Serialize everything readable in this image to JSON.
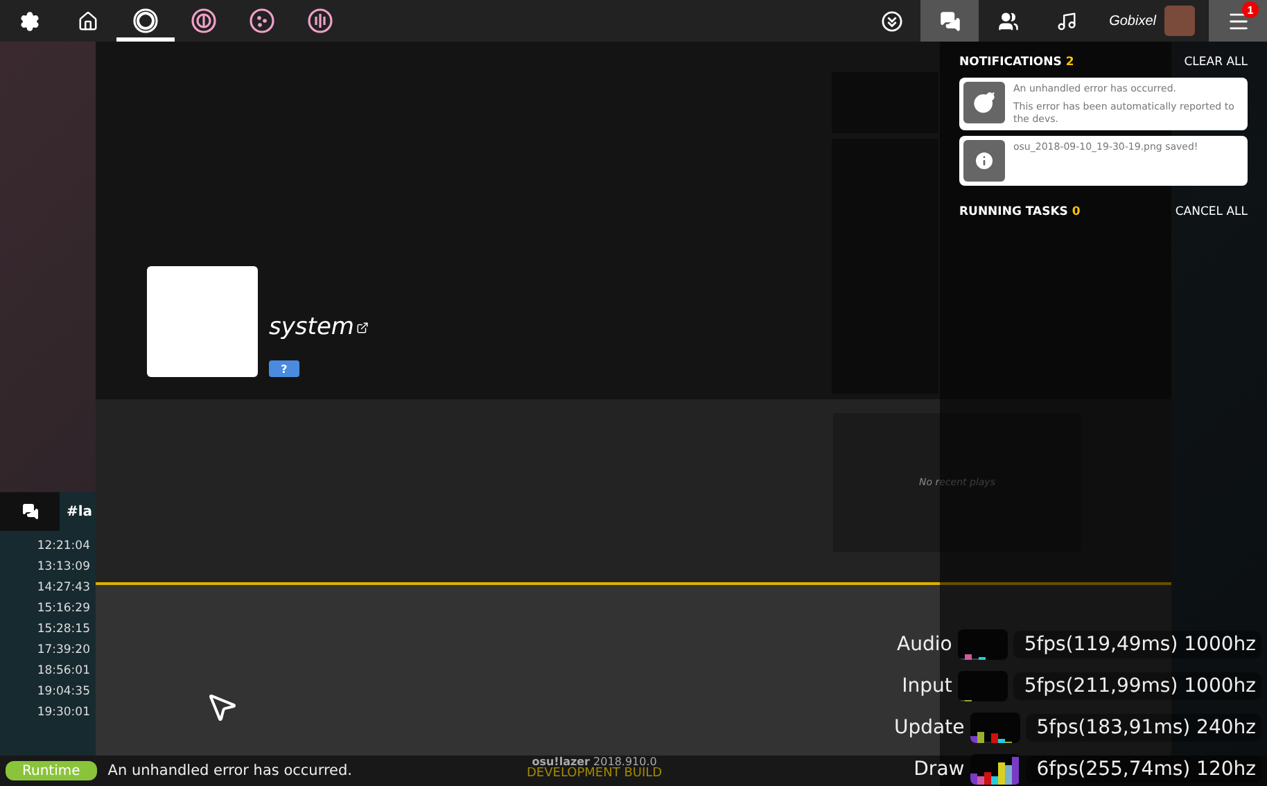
{
  "toolbar": {
    "rulesets": [
      {
        "kind": "osu",
        "selected": true
      },
      {
        "kind": "taiko",
        "selected": false
      },
      {
        "kind": "catch",
        "selected": false
      },
      {
        "kind": "mania",
        "selected": false
      }
    ],
    "buttons": [
      {
        "kind": "direct",
        "selected": false
      },
      {
        "kind": "chat",
        "selected": true
      },
      {
        "kind": "social",
        "selected": false
      },
      {
        "kind": "music",
        "selected": false
      }
    ],
    "user": {
      "name": "Gobixel"
    },
    "menu": {
      "selected": true,
      "badge": "1"
    }
  },
  "profile": {
    "username": "system",
    "badge": "?",
    "recent_plays": "No recent plays"
  },
  "notifications": {
    "title": "NOTIFICATIONS",
    "count": "2",
    "clear": "CLEAR ALL",
    "items": [
      {
        "kind": "error",
        "lines": [
          "An unhandled error has occurred.",
          "This error has been automatically reported to the devs."
        ]
      },
      {
        "kind": "info",
        "lines": [
          "osu_2018-09-10_19-30-19.png saved!"
        ]
      }
    ],
    "tasks_title": "RUNNING TASKS",
    "tasks_count": "0",
    "cancel": "CANCEL ALL"
  },
  "chat": {
    "channel": "#la",
    "times": [
      "12:21:04",
      "13:13:09",
      "14:27:43",
      "15:16:29",
      "15:28:15",
      "17:39:20",
      "18:56:01",
      "19:04:35",
      "19:30:01"
    ]
  },
  "status": {
    "tag": "Runtime",
    "message": "An unhandled error has occurred."
  },
  "version": {
    "name": "osu!lazer",
    "number": "2018.910.0",
    "build": "DEVELOPMENT BUILD"
  },
  "fps": [
    {
      "label": "Audio",
      "reading": "5fps(119,49ms)",
      "rate": "1000hz"
    },
    {
      "label": "Input",
      "reading": "5fps(211,99ms)",
      "rate": "1000hz"
    },
    {
      "label": "Update",
      "reading": "5fps(183,91ms)",
      "rate": "240hz"
    },
    {
      "label": "Draw",
      "reading": "6fps(255,74ms)",
      "rate": "120hz"
    }
  ]
}
